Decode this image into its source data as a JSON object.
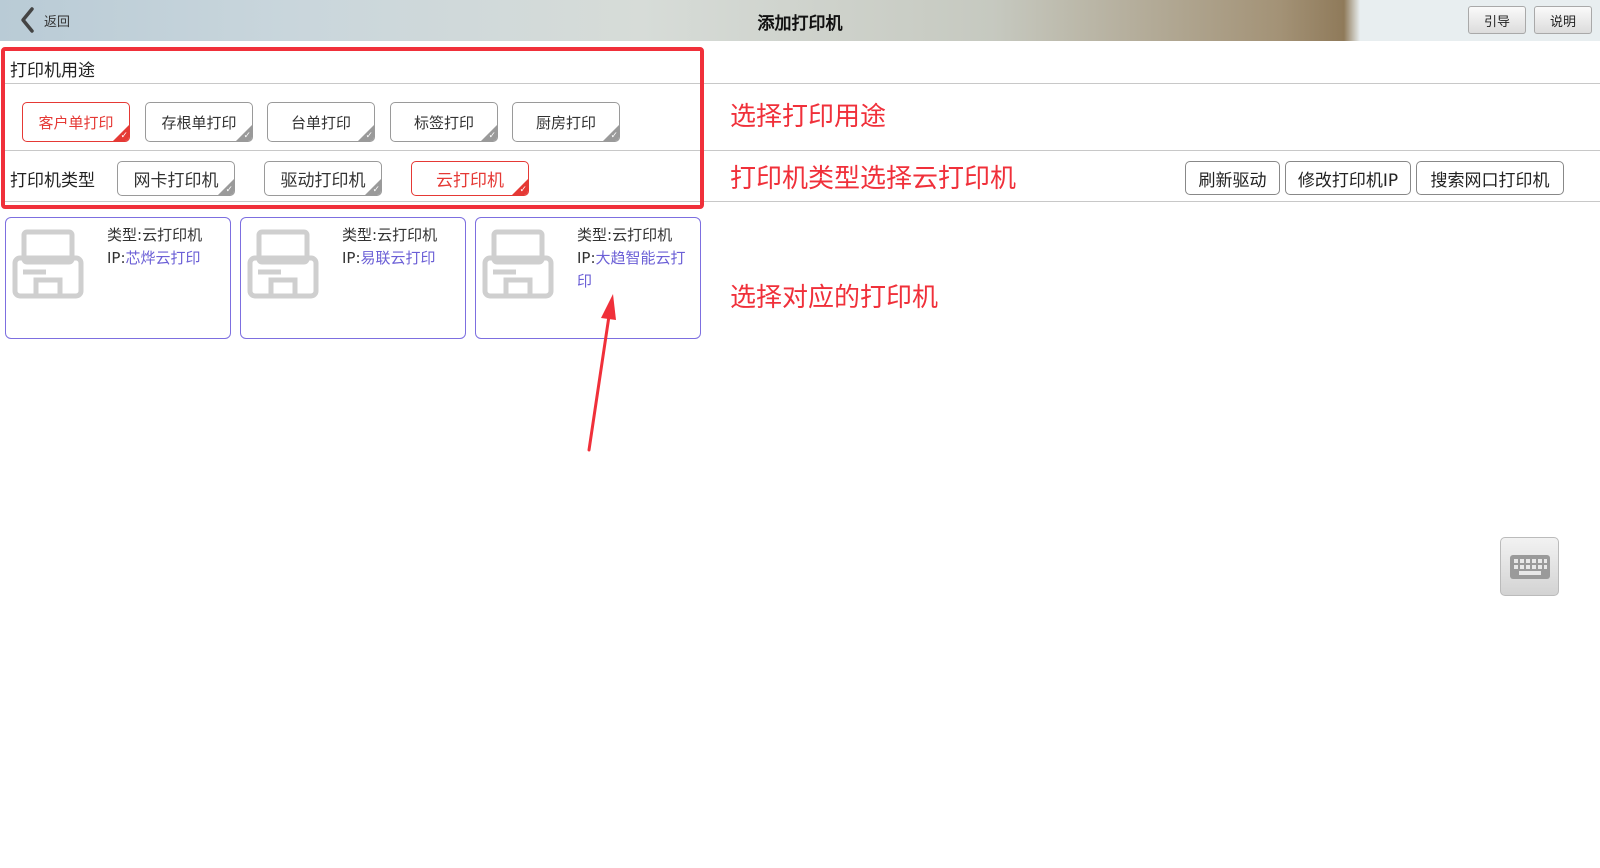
{
  "header": {
    "back_label": "返回",
    "title": "添加打印机",
    "guide_label": "引导",
    "help_label": "说明"
  },
  "usage": {
    "label": "打印机用途",
    "options": [
      "客户单打印",
      "存根单打印",
      "台单打印",
      "标签打印",
      "厨房打印"
    ],
    "selected": "客户单打印"
  },
  "type": {
    "label": "打印机类型",
    "options": [
      "网卡打印机",
      "驱动打印机",
      "云打印机"
    ],
    "selected": "云打印机"
  },
  "toolbar": {
    "refresh_driver": "刷新驱动",
    "modify_ip": "修改打印机IP",
    "search_network": "搜索网口打印机"
  },
  "printers": [
    {
      "type_prefix": "类型:",
      "type_value": "云打印机",
      "ip_prefix": "IP:",
      "ip_value": "芯烨云打印"
    },
    {
      "type_prefix": "类型:",
      "type_value": "云打印机",
      "ip_prefix": "IP:",
      "ip_value": "易联云打印"
    },
    {
      "type_prefix": "类型:",
      "type_value": "云打印机",
      "ip_prefix": "IP:",
      "ip_value": "大趋智能云打印"
    }
  ],
  "annotations": {
    "select_usage": "选择打印用途",
    "select_type": "打印机类型选择云打印机",
    "select_printer": "选择对应的打印机"
  },
  "colors": {
    "accent_red": "#f0303a",
    "card_border": "#7d6fe0",
    "ip_text": "#6b5fd6"
  },
  "icons": [
    "back-chevron-icon",
    "printer-icon",
    "keyboard-icon",
    "check-icon"
  ]
}
